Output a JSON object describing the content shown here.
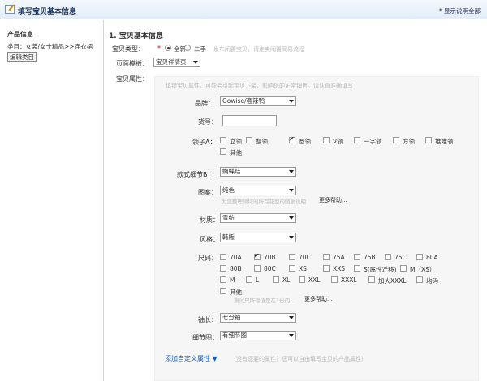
{
  "header": {
    "title": "填写宝贝基本信息",
    "help_link": "* 显示说明全部"
  },
  "sidebar": {
    "section_title": "产品信息",
    "category_path": "类目：女装/女士精品>>连衣裙",
    "edit_button": "编辑类目"
  },
  "main": {
    "title": "1. 宝贝基本信息",
    "item_type": {
      "label": "宝贝类型：",
      "required": "*",
      "options": [
        "全新",
        "二手"
      ],
      "selected": "全新",
      "hint": "发布闲置宝贝，请走卖闲置简易流程"
    },
    "template": {
      "label": "页面模板：",
      "value": "宝贝详情页"
    },
    "attrs": {
      "label": "宝贝属性：",
      "hint": "填错宝贝属性，可能会引起宝贝下架，影响您的正常销售。请认真准确填写",
      "brand": {
        "label": "品牌：",
        "value": "Gowise/套辣鸭"
      },
      "model": {
        "label": "货号：",
        "value": ""
      },
      "collar": {
        "label": "领子A：",
        "options": [
          {
            "text": "立领",
            "checked": false
          },
          {
            "text": "翻领",
            "checked": false
          },
          {
            "text": "圆领",
            "checked": true
          },
          {
            "text": "V领",
            "checked": false
          },
          {
            "text": "一字领",
            "checked": false
          },
          {
            "text": "方领",
            "checked": false
          },
          {
            "text": "堆堆领",
            "checked": false
          },
          {
            "text": "其他",
            "checked": false
          }
        ]
      },
      "style_detail": {
        "label": "款式细节B：",
        "value": "蝴蝶结"
      },
      "pattern": {
        "label": "图案：",
        "value": "纯色",
        "hint": "为您整理领域的所有花型的图案说明",
        "more": "更多帮助..."
      },
      "material": {
        "label": "材质：",
        "value": "雪纺"
      },
      "style": {
        "label": "风格：",
        "value": "韩版"
      },
      "size": {
        "label": "尺码：",
        "options": [
          {
            "text": "70A",
            "checked": false
          },
          {
            "text": "70B",
            "checked": true
          },
          {
            "text": "70C",
            "checked": false
          },
          {
            "text": "75A",
            "checked": false
          },
          {
            "text": "75B",
            "checked": false
          },
          {
            "text": "75C",
            "checked": false
          },
          {
            "text": "80A",
            "checked": false
          },
          {
            "text": "80B",
            "checked": false
          },
          {
            "text": "80C",
            "checked": false
          },
          {
            "text": "XS",
            "checked": false
          },
          {
            "text": "XXS",
            "checked": false
          },
          {
            "text": "S(属性迁移)",
            "checked": false
          },
          {
            "text": "M（XS）",
            "checked": false
          },
          {
            "text": "M",
            "checked": false
          },
          {
            "text": "L",
            "checked": false
          },
          {
            "text": "XL",
            "checked": false
          },
          {
            "text": "XXL",
            "checked": false
          },
          {
            "text": "XXXL",
            "checked": false
          },
          {
            "text": "加大XXXL",
            "checked": false
          },
          {
            "text": "均码",
            "checked": false
          },
          {
            "text": "其他",
            "checked": false
          }
        ],
        "hint": "测试只所得值是在1份的...",
        "more": "更多帮助..."
      },
      "sleeve": {
        "label": "袖长：",
        "value": "七分袖"
      },
      "detail": {
        "label": "细节图：",
        "value": "有细节图"
      },
      "add_custom": {
        "label": "添加自定义属性",
        "hint": "（没有您要的属性？您可以自由填写宝贝的产品属性）"
      }
    }
  }
}
